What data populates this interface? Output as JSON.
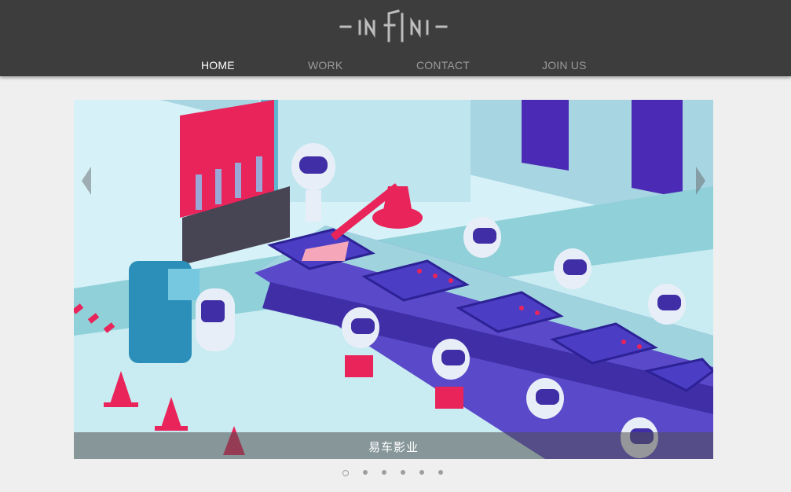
{
  "brand": {
    "logo_text": "INFINI"
  },
  "nav": {
    "items": [
      {
        "label": "HOME",
        "active": true
      },
      {
        "label": "WORK",
        "active": false
      },
      {
        "label": "CONTACT",
        "active": false
      },
      {
        "label": "JOIN US",
        "active": false
      }
    ]
  },
  "slider": {
    "caption": "易车影业",
    "current_index": 1,
    "total_slides": 6,
    "prev_icon": "chevron-left-icon",
    "next_icon": "chevron-right-icon"
  },
  "colors": {
    "header_bg": "#3d3d3d",
    "page_bg": "#efefef",
    "accent_pink": "#e8245a",
    "factory_purple": "#4a2fb8",
    "factory_teal": "#9fd4df"
  }
}
